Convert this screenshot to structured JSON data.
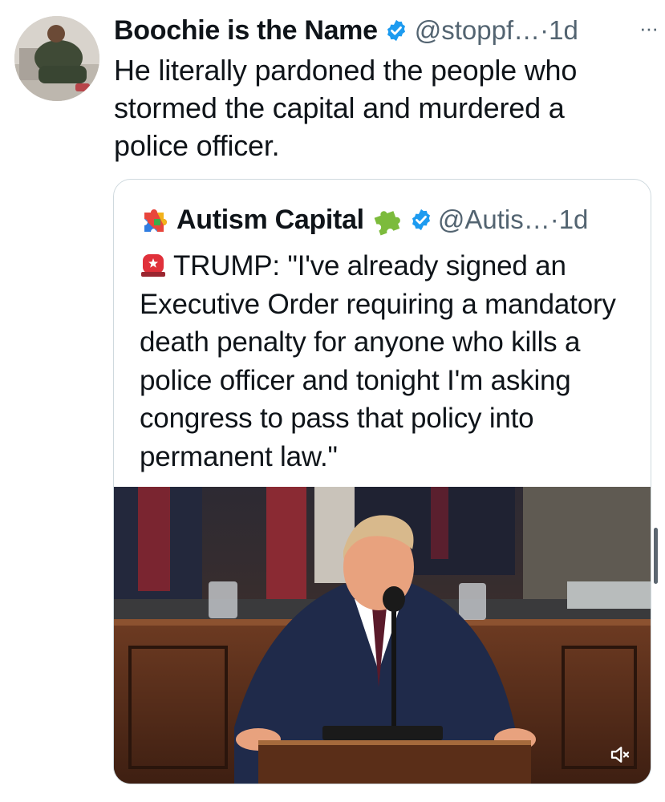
{
  "tweet": {
    "display_name": "Boochie is the Name",
    "handle": "@stoppf…",
    "time": "·1d",
    "more": "···",
    "text": "He literally pardoned the people who stormed the capital and murdered a police officer."
  },
  "quote": {
    "display_name": "Autism Capital",
    "handle": "@Autis…",
    "time": "·1d",
    "text": "TRUMP: \"I've already signed an Executive Order requiring a mandatory death penalty for anyone who kills a police officer and tonight I'm asking congress to pass that policy into permanent law.\"",
    "media_type": "video",
    "media_muted": true
  },
  "colors": {
    "verified_blue": "#1d9bf0",
    "text_primary": "#0f1419",
    "text_secondary": "#536471",
    "card_border": "#cfd9de"
  },
  "icons": {
    "verified": "verified-badge-icon",
    "more": "more-icon",
    "mute": "volume-muted-icon",
    "rainbow_puzzle": "rainbow-puzzle-icon",
    "green_puzzle": "green-puzzle-icon",
    "siren": "siren-icon"
  }
}
